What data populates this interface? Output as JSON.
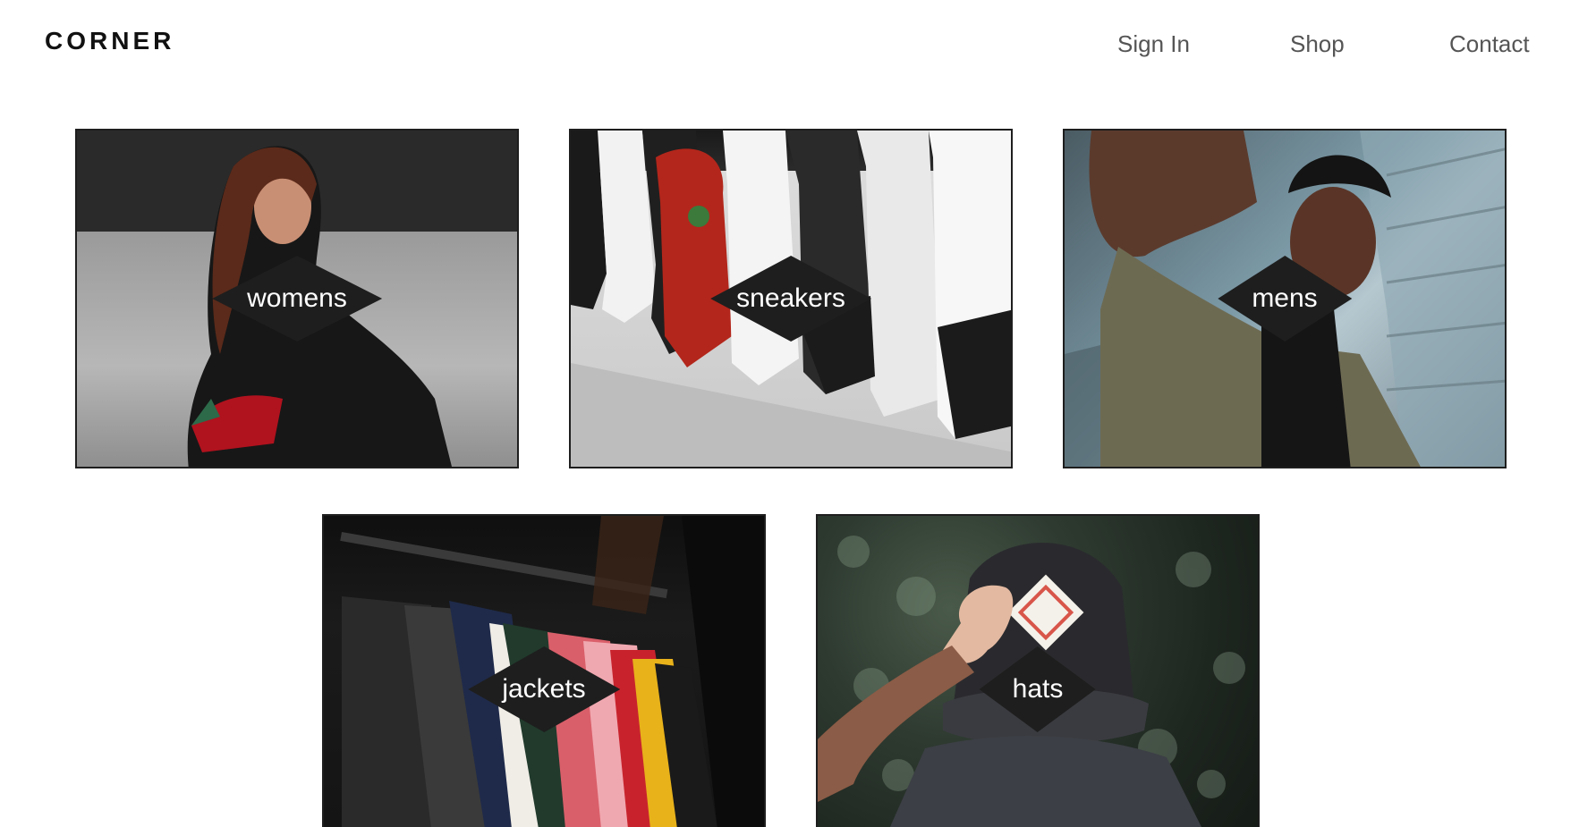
{
  "header": {
    "logo": "CORNER",
    "nav": {
      "sign_in": "Sign In",
      "shop": "Shop",
      "contact": "Contact"
    }
  },
  "categories": [
    {
      "label": "womens"
    },
    {
      "label": "sneakers"
    },
    {
      "label": "mens"
    },
    {
      "label": "jackets"
    },
    {
      "label": "hats"
    }
  ],
  "colors": {
    "label_diamond": "#1e1e1e",
    "label_text": "#ffffff",
    "nav_text": "#555555",
    "logo_text": "#111111"
  }
}
